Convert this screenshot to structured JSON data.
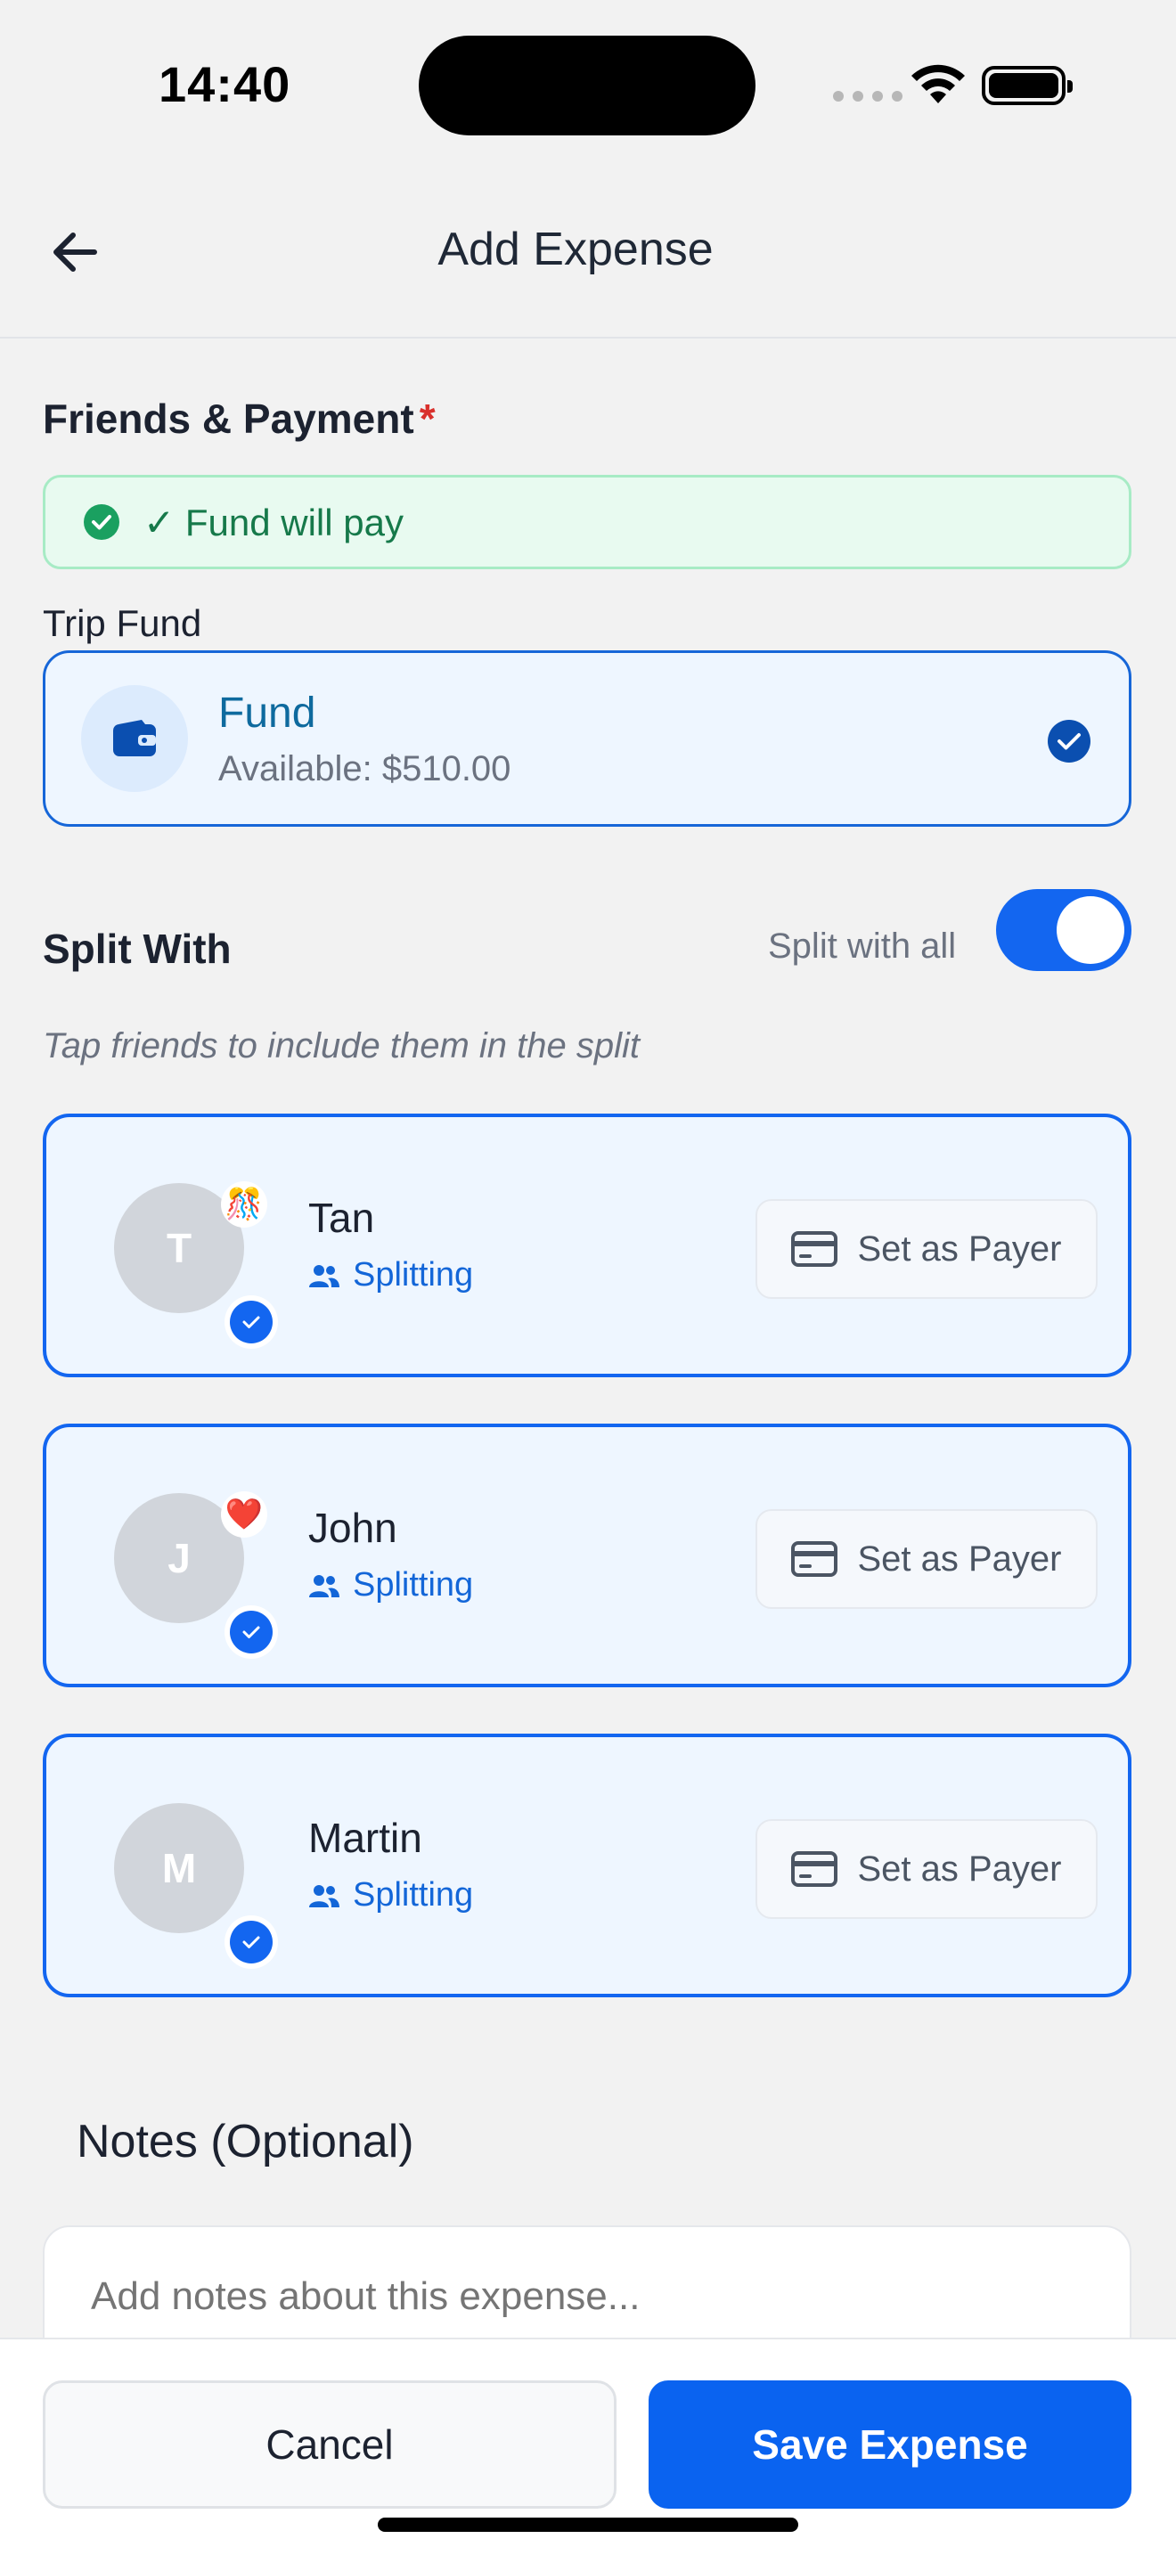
{
  "status_bar": {
    "time": "14:40"
  },
  "header": {
    "title": "Add Expense"
  },
  "friends_payment": {
    "label": "Friends & Payment",
    "required_mark": "*",
    "banner_text": "✓ Fund will pay"
  },
  "trip_fund": {
    "label": "Trip Fund",
    "name": "Fund",
    "available": "Available: $510.00",
    "selected": true
  },
  "split": {
    "label": "Split With",
    "split_all_label": "Split with all",
    "split_all_on": true,
    "hint": "Tap friends to include them in the split"
  },
  "friends": [
    {
      "initial": "T",
      "name": "Tan",
      "status": "Splitting",
      "payer_label": "Set as Payer",
      "badge": "🎊",
      "selected": true
    },
    {
      "initial": "J",
      "name": "John",
      "status": "Splitting",
      "payer_label": "Set as Payer",
      "badge": "❤️",
      "selected": true
    },
    {
      "initial": "M",
      "name": "Martin",
      "status": "Splitting",
      "payer_label": "Set as Payer",
      "badge": "",
      "selected": true
    }
  ],
  "notes": {
    "label": "Notes (Optional)",
    "placeholder": "Add notes about this expense..."
  },
  "footer": {
    "cancel_label": "Cancel",
    "save_label": "Save Expense"
  },
  "colors": {
    "accent": "#1366f0",
    "success": "#16794a",
    "fund_text": "#0e6a9e"
  }
}
